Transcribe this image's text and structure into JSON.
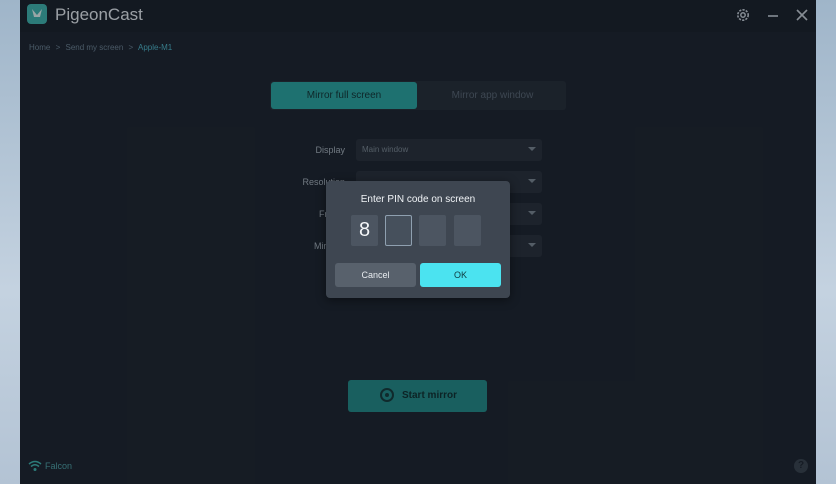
{
  "app": {
    "title": "PigeonCast"
  },
  "breadcrumb": {
    "items": [
      "Home",
      ">",
      "Send my screen",
      ">",
      "Apple-M1"
    ]
  },
  "mode_tabs": {
    "full_screen": "Mirror full screen",
    "app_window": "Mirror app window"
  },
  "settings": {
    "display_label": "Display",
    "display_value": "Main window",
    "resolution_label": "Resolution",
    "resolution_value": "",
    "frame_label": "Frame",
    "frame_value": "",
    "mirror_label": "Mirror d",
    "mirror_value": ""
  },
  "start_button": {
    "label": "Start mirror"
  },
  "status": {
    "text": "Falcon"
  },
  "help": {
    "label": "?"
  },
  "pin_dialog": {
    "title": "Enter PIN code on screen",
    "digits": [
      "8",
      "",
      "",
      ""
    ],
    "cancel_label": "Cancel",
    "ok_label": "OK"
  },
  "colors": {
    "accent": "#2aa6a2",
    "ok_button": "#4be3f0",
    "window_bg": "#1d232d"
  }
}
